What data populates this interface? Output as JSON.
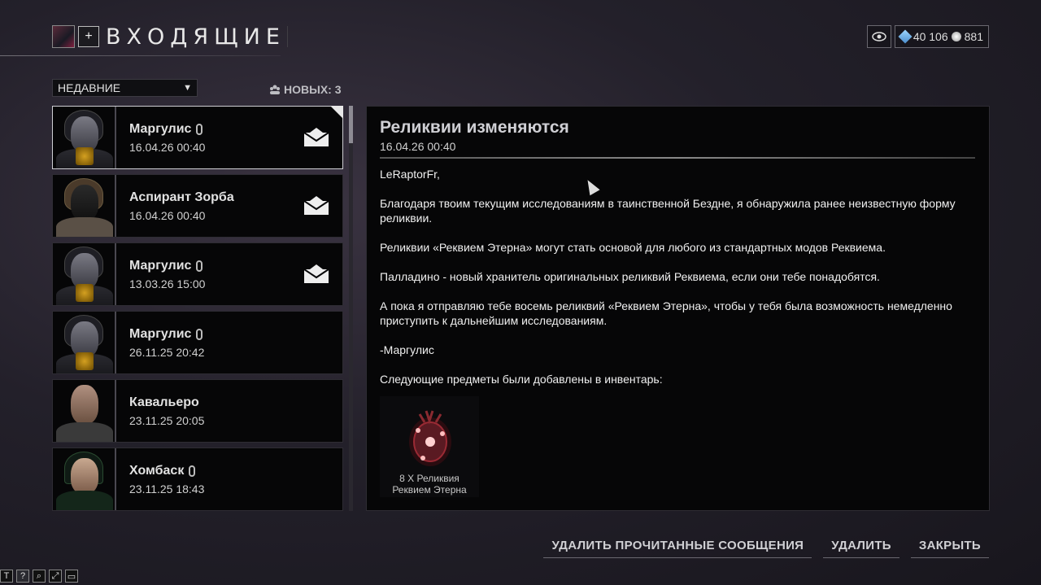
{
  "header": {
    "title": "ВХОДЯЩИЕ",
    "add_label": "+"
  },
  "currency": {
    "platinum": "40 106",
    "credits": "881"
  },
  "filter": {
    "selected": "НЕДАВНИЕ",
    "new_label": "НОВЫХ: 3"
  },
  "messages": [
    {
      "sender": "Маргулис",
      "date": "16.04.26 00:40",
      "attachment": true,
      "unread": true,
      "selected": true
    },
    {
      "sender": "Аспирант Зорба",
      "date": "16.04.26 00:40",
      "attachment": false,
      "unread": true,
      "selected": false
    },
    {
      "sender": "Маргулис",
      "date": "13.03.26 15:00",
      "attachment": true,
      "unread": true,
      "selected": false
    },
    {
      "sender": "Маргулис",
      "date": "26.11.25 20:42",
      "attachment": true,
      "unread": false,
      "selected": false
    },
    {
      "sender": "Кавальеро",
      "date": "23.11.25 20:05",
      "attachment": false,
      "unread": false,
      "selected": false
    },
    {
      "sender": "Хомбаск",
      "date": "23.11.25 18:43",
      "attachment": true,
      "unread": false,
      "selected": false
    }
  ],
  "view": {
    "subject": "Реликвии изменяются",
    "date": "16.04.26 00:40",
    "paragraphs": [
      "LeRaptorFr,",
      "Благодаря твоим текущим исследованиям в таинственной Бездне, я обнаружила ранее неизвестную форму реликвии.",
      "Реликвии «Реквием Этерна» могут стать основой для любого из стандартных модов Реквиема.",
      "Палладино - новый хранитель оригинальных реликвий Реквиема, если они тебе понадобятся.",
      "А пока я отправляю тебе восемь реликвий «Реквием Этерна», чтобы у тебя была возможность немедленно приступить к дальнейшим исследованиям.",
      "-Маргулис",
      "Следующие предметы были добавлены в инвентарь:"
    ],
    "item": {
      "line1": "8 X Реликвия",
      "line2": "Реквием Этерна"
    }
  },
  "actions": {
    "delete_read": "УДАЛИТЬ ПРОЧИТАННЫЕ СООБЩЕНИЯ",
    "delete": "УДАЛИТЬ",
    "close": "ЗАКРЫТЬ"
  },
  "toolbar": [
    "T",
    "?"
  ],
  "colors": {
    "accent": "#cfcfd4",
    "background": "#23202a",
    "panel": "#060607"
  }
}
